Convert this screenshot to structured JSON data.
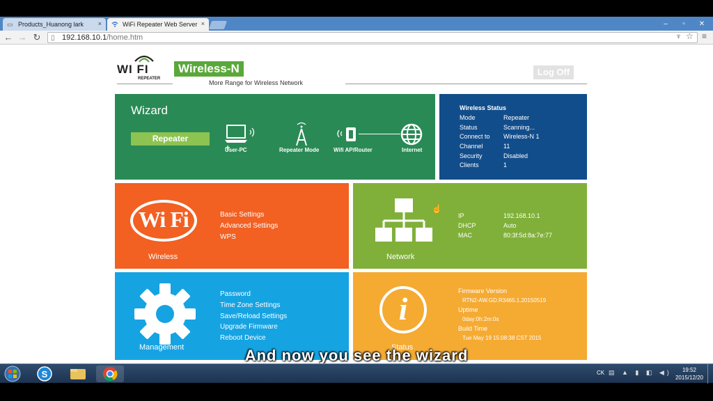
{
  "browser": {
    "tabs": [
      {
        "label": "Products_Huanong lark",
        "close": "×"
      },
      {
        "label": "WiFi Repeater Web Server",
        "close": "×"
      }
    ],
    "window_controls": [
      "–",
      "▫",
      "✕"
    ],
    "url_host": "192.168.10.1",
    "url_path": "/home.htm"
  },
  "header": {
    "logo_text": "WI FI",
    "logo_sub": "REPEATER",
    "badge": "Wireless-N",
    "tagline": "More Range for Wireless Network",
    "logoff": "Log Off"
  },
  "wizard": {
    "title": "Wizard",
    "button": "Repeater",
    "diagram": [
      "User-PC",
      "Repeater Mode",
      "Wifi AP/Router",
      "Internet"
    ]
  },
  "wireless_status": {
    "title": "Wireless Status",
    "rows": [
      {
        "k": "Mode",
        "v": "Repeater"
      },
      {
        "k": "Status",
        "v": "Scanning..."
      },
      {
        "k": "Connect to",
        "v": "Wireless-N 1"
      },
      {
        "k": "Channel",
        "v": "11"
      },
      {
        "k": "Security",
        "v": "Disabled"
      },
      {
        "k": "Clients",
        "v": "1"
      }
    ]
  },
  "wireless": {
    "caption": "Wireless",
    "icon_text": "Wi Fi",
    "menu": [
      "Basic Settings",
      "Advanced Settings",
      "WPS"
    ]
  },
  "network": {
    "caption": "Network",
    "rows": [
      {
        "k": "IP",
        "v": "192.168.10.1"
      },
      {
        "k": "DHCP",
        "v": "Auto"
      },
      {
        "k": "MAC",
        "v": "80:3f:5d:8a:7e:77"
      }
    ]
  },
  "management": {
    "caption": "Management",
    "menu": [
      "Password",
      "Time Zone Settings",
      "Save/Reload Settings",
      "Upgrade Firmware",
      "Reboot Device"
    ]
  },
  "status": {
    "caption": "Status",
    "icon_text": "i",
    "items": [
      {
        "label": "Firmware Version",
        "value": "RTN2-AW.GD.R3465.1.20150519"
      },
      {
        "label": "Uptime",
        "value": "0day:0h:2m:0s"
      },
      {
        "label": "Build Time",
        "value": "Tue May 19 15:08:38 CST 2015"
      }
    ]
  },
  "subtitle": "And now you see the wizard",
  "taskbar": {
    "lang": "CK",
    "time": "19:52",
    "date": "2015/12/20"
  },
  "colors": {
    "wizard": "#2a8a55",
    "wireless_status": "#124d8b",
    "wireless": "#f26022",
    "network": "#80b03a",
    "management": "#16a3e2",
    "status": "#f5aa32",
    "badge": "#5aa83a"
  }
}
